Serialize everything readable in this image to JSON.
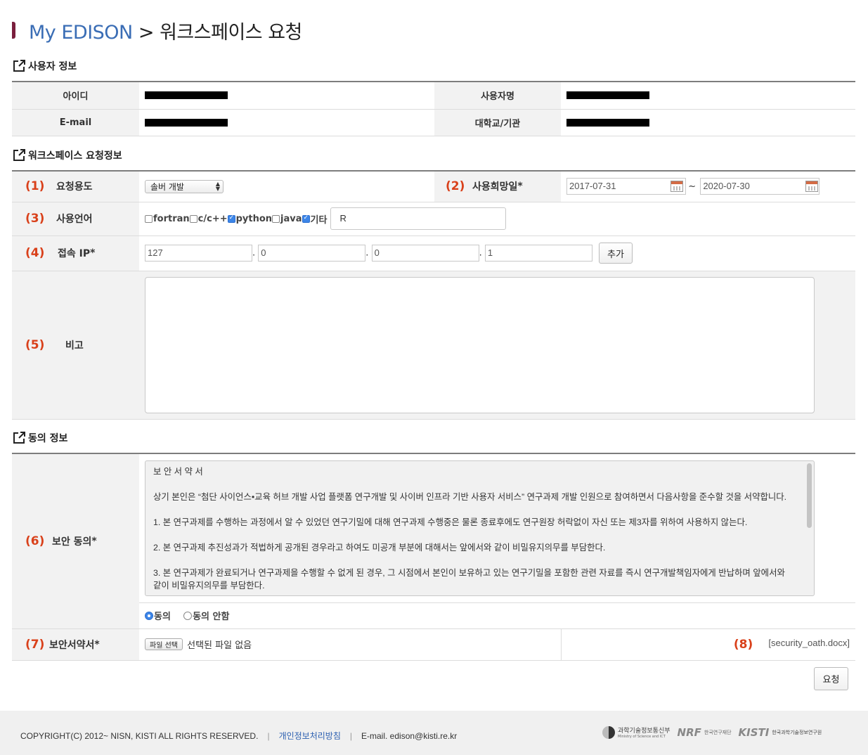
{
  "breadcrumb": {
    "brand": "My EDISON",
    "separator": ">",
    "current": "워크스페이스 요청"
  },
  "sections": {
    "user_info": "사용자 정보",
    "workspace_request": "워크스페이스 요청정보",
    "consent": "동의 정보"
  },
  "user_info": {
    "id_label": "아이디",
    "name_label": "사용자명",
    "email_label": "E-mail",
    "org_label": "대학교/기관"
  },
  "request": {
    "purpose": {
      "num": "(1)",
      "label": "요청용도",
      "selected": "솔버 개발"
    },
    "period": {
      "num": "(2)",
      "label": "사용희망일",
      "required": "*",
      "start": "2017-07-31",
      "tilde": "~",
      "end": "2020-07-30"
    },
    "language": {
      "num": "(3)",
      "label": "사용언어",
      "options": [
        {
          "label": "fortran",
          "checked": false
        },
        {
          "label": "c/c++",
          "checked": false
        },
        {
          "label": "python",
          "checked": true
        },
        {
          "label": "java",
          "checked": false
        },
        {
          "label": "기타",
          "checked": true
        }
      ],
      "other_value": "R"
    },
    "ip": {
      "num": "(4)",
      "label": "접속 IP",
      "required": "*",
      "octets": [
        "127",
        "0",
        "0",
        "1"
      ],
      "dot": ".",
      "add_button": "추가"
    },
    "remark": {
      "num": "(5)",
      "label": "비고"
    }
  },
  "consent": {
    "security": {
      "num": "(6)",
      "label": "보안 동의",
      "required": "*",
      "title": "보 안 서 약 서",
      "intro": "상기 본인은 “첨단 사이언스•교육 허브 개발 사업 플랫폼 연구개발 및 사이버 인프라 기반 사용자 서비스” 연구과제 개발 인원으로 참여하면서 다음사항을 준수할 것을 서약합니다.",
      "items": [
        "1. 본 연구과제를 수행하는 과정에서 알 수 있었던 연구기밀에 대해 연구과제 수행중은 물론 종료후에도 연구원장 허락없이 자신 또는 제3자를 위하여 사용하지 않는다.",
        "2. 본 연구과제 추진성과가 적법하게 공개된 경우라고 하여도 미공개 부분에 대해서는 앞에서와 같이 비밀유지의무를 부담한다.",
        "3. 본 연구과제가 완료되거나 연구과제을 수행할 수 없게 된 경우, 그 시점에서 본인이 보유하고 있는 연구기밀을 포함한 관련 자료를 즉시 연구개발책임자에게 반납하며 앞에서와 같이 비밀유지의무를 부담한다."
      ],
      "agree": "동의",
      "disagree": "동의 안함"
    },
    "oath_file": {
      "num": "(7)",
      "label": "보안서약서",
      "required": "*",
      "file_button": "파일 선택",
      "file_status": "선택된 파일 없음",
      "num8": "(8)",
      "template_link": "[security_oath.docx]"
    }
  },
  "submit_button": "요청",
  "footer": {
    "copyright": "COPYRIGHT(C) 2012~ NISN, KISTI ALL RIGHTS RESERVED.",
    "privacy": "개인정보처리방침",
    "email": "E-mail. edison@kisti.re.kr",
    "logos": {
      "msit_ko": "과학기술정보통신부",
      "msit_en": "Ministry of Science and ICT",
      "nrf_mark": "NRF",
      "nrf_ko": "한국연구재단",
      "kisti_mark": "KISTI",
      "kisti_ko": "한국과학기술정보연구원"
    }
  }
}
